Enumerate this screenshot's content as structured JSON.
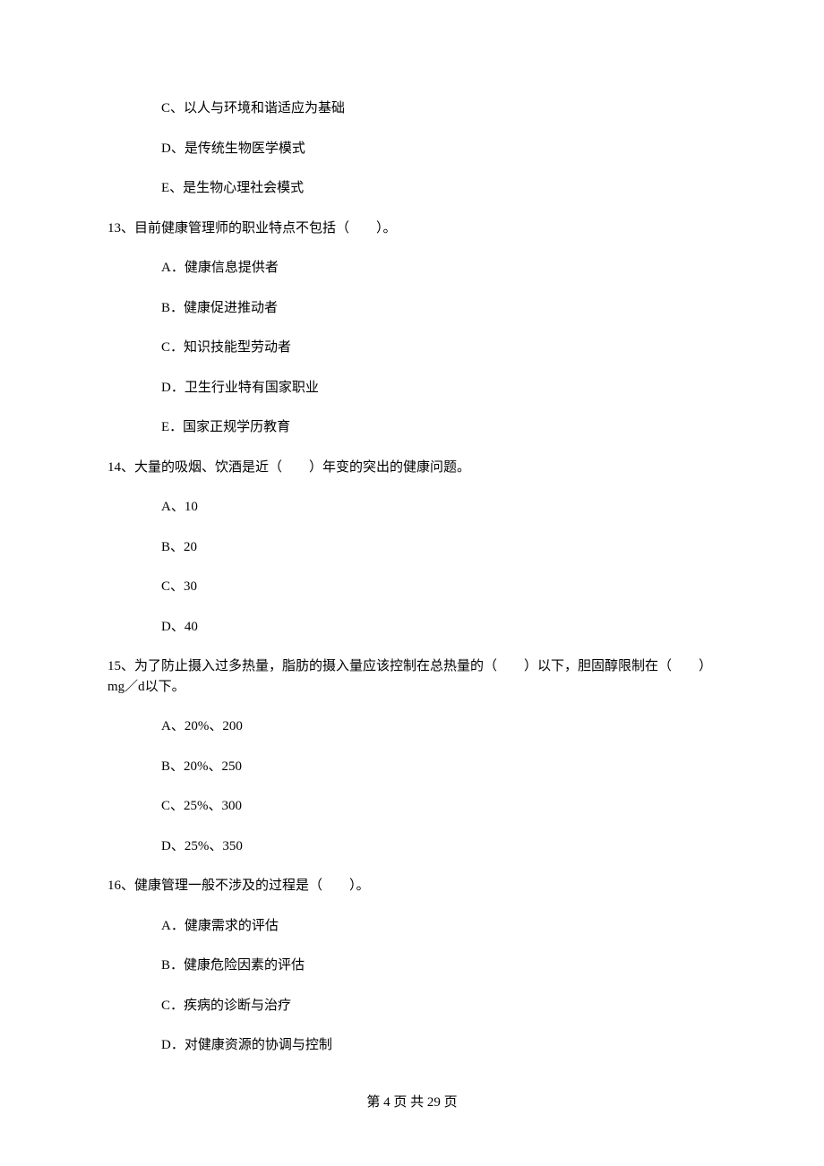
{
  "options_pre": [
    "C、以人与环境和谐适应为基础",
    "D、是传统生物医学模式",
    "E、是生物心理社会模式"
  ],
  "q13": {
    "stem": "13、目前健康管理师的职业特点不包括（　　）。",
    "options": [
      "A．健康信息提供者",
      "B．健康促进推动者",
      "C．知识技能型劳动者",
      "D．卫生行业特有国家职业",
      "E．国家正规学历教育"
    ]
  },
  "q14": {
    "stem": "14、大量的吸烟、饮酒是近（　　）年变的突出的健康问题。",
    "options": [
      "A、10",
      "B、20",
      "C、30",
      "D、40"
    ]
  },
  "q15": {
    "stem": "15、为了防止摄入过多热量，脂肪的摄入量应该控制在总热量的（　　）以下，胆固醇限制在（　　）mg／d以下。",
    "options": [
      "A、20%、200",
      "B、20%、250",
      "C、25%、300",
      "D、25%、350"
    ]
  },
  "q16": {
    "stem": "16、健康管理一般不涉及的过程是（　　）。",
    "options": [
      "A．健康需求的评估",
      "B．健康危险因素的评估",
      "C．疾病的诊断与治疗",
      "D．对健康资源的协调与控制"
    ]
  },
  "footer": "第 4 页 共 29 页"
}
